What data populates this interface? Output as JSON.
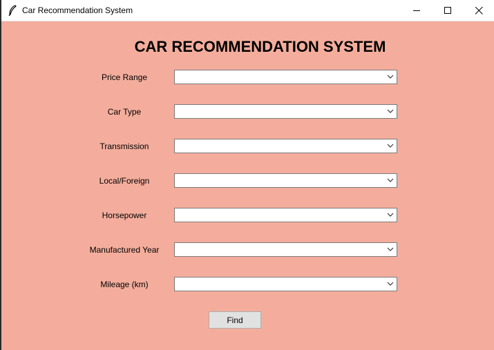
{
  "window": {
    "title": "Car Recommendation System",
    "icon": "feather-icon",
    "controls": [
      "minimize-icon",
      "maximize-icon",
      "close-icon"
    ]
  },
  "form": {
    "heading": "CAR RECOMMENDATION SYSTEM",
    "fields": [
      {
        "label": "Price Range",
        "value": ""
      },
      {
        "label": "Car Type",
        "value": ""
      },
      {
        "label": "Transmission",
        "value": ""
      },
      {
        "label": "Local/Foreign",
        "value": ""
      },
      {
        "label": "Horsepower",
        "value": ""
      },
      {
        "label": "Manufactured Year",
        "value": ""
      },
      {
        "label": "Mileage (km)",
        "value": ""
      }
    ],
    "submit_label": "Find"
  },
  "colors": {
    "background": "#f4ad9c",
    "titlebar": "#ffffff",
    "button": "#e1e1e1"
  }
}
